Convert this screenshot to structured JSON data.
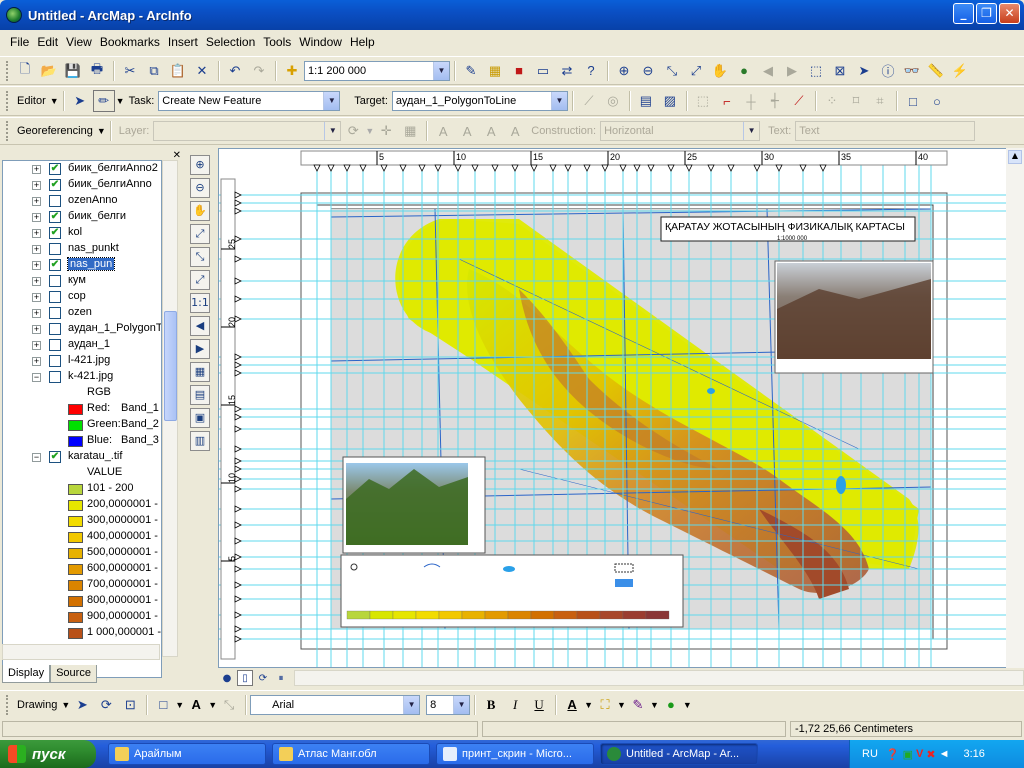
{
  "window": {
    "title": "Untitled - ArcMap - ArcInfo"
  },
  "menu": [
    "File",
    "Edit",
    "View",
    "Bookmarks",
    "Insert",
    "Selection",
    "Tools",
    "Window",
    "Help"
  ],
  "standard_toolbar": {
    "scale": "1:1 200 000"
  },
  "editor_toolbar": {
    "editor_label": "Editor",
    "task_label": "Task:",
    "task_value": "Create New Feature",
    "target_label": "Target:",
    "target_value": "аудан_1_PolygonToLine"
  },
  "georef_toolbar": {
    "georef_label": "Georeferencing",
    "layer_label": "Layer:",
    "construction_label": "Construction:",
    "construction_value": "Horizontal",
    "text_label": "Text:",
    "text_value": "Text"
  },
  "toc": {
    "layers": [
      {
        "name": "биик_белгиAnno2",
        "checked": true,
        "expanded": false
      },
      {
        "name": "биик_белгиAnno",
        "checked": true,
        "expanded": false
      },
      {
        "name": "ozenAnno",
        "checked": false,
        "expanded": false
      },
      {
        "name": "биик_белги",
        "checked": true,
        "expanded": false
      },
      {
        "name": "kol",
        "checked": true,
        "expanded": false
      },
      {
        "name": "nas_punkt",
        "checked": false,
        "expanded": false
      },
      {
        "name": "nas_pun",
        "checked": true,
        "expanded": false,
        "selected": true
      },
      {
        "name": "кум",
        "checked": false,
        "expanded": false
      },
      {
        "name": "cop",
        "checked": false,
        "expanded": false
      },
      {
        "name": "ozen",
        "checked": false,
        "expanded": false
      },
      {
        "name": "аудан_1_PolygonT",
        "checked": false,
        "expanded": false
      },
      {
        "name": "аудан_1",
        "checked": false,
        "expanded": false
      },
      {
        "name": "l-421.jpg",
        "checked": false,
        "expanded": false
      },
      {
        "name": "k-421.jpg",
        "checked": false,
        "expanded": true
      }
    ],
    "rgb_heading": "RGB",
    "rgb_bands": [
      {
        "label": "Red:",
        "band": "Band_1",
        "color": "#ff0000"
      },
      {
        "label": "Green:",
        "band": "Band_2",
        "color": "#00e000"
      },
      {
        "label": "Blue:",
        "band": "Band_3",
        "color": "#0000ff"
      }
    ],
    "raster_layer": {
      "name": "karatau_.tif",
      "checked": true
    },
    "value_heading": "VALUE",
    "value_classes": [
      {
        "label": "101 - 200",
        "color": "#b8d63c"
      },
      {
        "label": "200,0000001 -",
        "color": "#e6e600"
      },
      {
        "label": "300,0000001 -",
        "color": "#f2dc00"
      },
      {
        "label": "400,0000001 -",
        "color": "#f2c800"
      },
      {
        "label": "500,0000001 -",
        "color": "#e8b200"
      },
      {
        "label": "600,0000001 -",
        "color": "#e39a00"
      },
      {
        "label": "700,0000001 -",
        "color": "#db8400"
      },
      {
        "label": "800,0000001 -",
        "color": "#d27000"
      },
      {
        "label": "900,0000001 -",
        "color": "#c86010"
      },
      {
        "label": "1 000,000001 -",
        "color": "#b85018"
      }
    ],
    "tabs": [
      "Display",
      "Source"
    ]
  },
  "map": {
    "title": "ҚАРАТАУ ЖОТАСЫНЫҢ ФИЗИКАЛЫҚ КАРТАСЫ",
    "scale_text": "1:1000 000",
    "ruler_top": [
      "5",
      "10",
      "15",
      "20",
      "25",
      "30",
      "35",
      "40"
    ],
    "ruler_left": [
      "25",
      "20",
      "15",
      "10",
      "5"
    ]
  },
  "drawing_toolbar": {
    "drawing_label": "Drawing",
    "font": "Arial",
    "size": "8",
    "bold": "B",
    "italic": "I",
    "underline": "U"
  },
  "status": {
    "coords": "-1,72  25,66 Centimeters"
  },
  "taskbar": {
    "start": "пуск",
    "tasks": [
      "Арайлым",
      "Атлас Манг.обл",
      "принт_скрин - Micro...",
      "Untitled - ArcMap - Ar..."
    ],
    "lang": "RU",
    "time": "3:16"
  },
  "colors": {
    "accent": "#0a5fd8",
    "selection": "#316ac5"
  }
}
